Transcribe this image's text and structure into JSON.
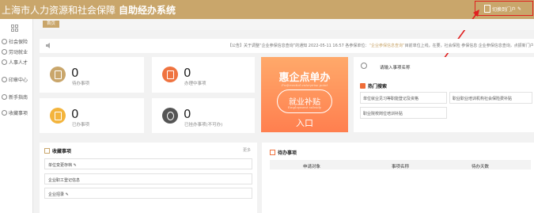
{
  "header": {
    "title_main": "上海市人力资源和社会保障",
    "title_sub": "自助经办系统",
    "switch_label": "切换到门户",
    "bg_color": "#c9a66b",
    "highlight_color": "#e02020"
  },
  "sidebar": {
    "items": [
      {
        "label": "社会保险",
        "icon": "people-icon"
      },
      {
        "label": "劳动就业",
        "icon": "briefcase-icon"
      },
      {
        "label": "人事人才",
        "icon": "person-icon"
      },
      {
        "label": "印章中心",
        "icon": "stamp-icon"
      },
      {
        "label": "新手指南",
        "icon": "guide-icon"
      },
      {
        "label": "收藏事项",
        "icon": "star-icon"
      }
    ]
  },
  "tabs": {
    "home": "首页"
  },
  "notice": {
    "tag": "【公告】",
    "text_a": "关于调整“企业参保信息查询”的通知 2022-05-11 16:57 各参保单位：",
    "text_hl": "“企业参保信息查询”",
    "text_b": "目前单位上线，在要，社会保险 参保信息 企业参保信息查询，点振新门户"
  },
  "stats": [
    {
      "num": "0",
      "label": "待办事项",
      "color": "#c9a66b",
      "icon": "doc-icon"
    },
    {
      "num": "0",
      "label": "办理中事项",
      "color": "#ef7340",
      "icon": "doc-pen-icon"
    },
    {
      "num": "0",
      "label": "已办事项",
      "color": "#f3b43c",
      "icon": "doc-check-icon"
    },
    {
      "num": "0",
      "label": "已挂办事项(不可办)",
      "color": "#555555",
      "icon": "phone-icon"
    }
  ],
  "banner": {
    "line1": "惠企点单办",
    "line1_sub": "Preferential enterprise point",
    "line2": "就业补贴",
    "line2_sub": "Employment subsidy",
    "line3": "入口"
  },
  "search": {
    "placeholder": "请输入事项名称"
  },
  "hot": {
    "title": "热门搜索",
    "items": [
      "单位就业见习等职能登记及资格",
      "职业职业培训机构社会保险费补贴",
      "职业院校岗位培训补贴"
    ]
  },
  "favorites": {
    "title": "收藏事项",
    "more": "更多",
    "items": [
      "单位变更存档 ✎",
      "企业职工登记信息",
      "企业招录 ✎"
    ]
  },
  "todo": {
    "title": "待办事项",
    "columns": [
      "申请对象",
      "事项名称",
      "待办天数"
    ]
  }
}
